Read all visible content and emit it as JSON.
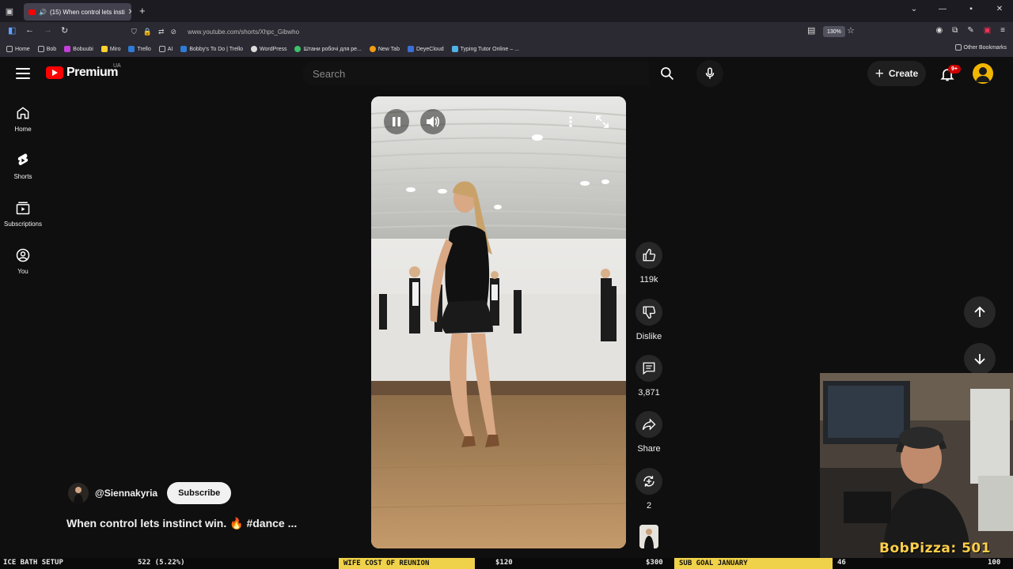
{
  "browser": {
    "tab_title": "(15) When control lets insti",
    "url": "www.youtube.com/shorts/Xhpc_Gibwho",
    "zoom": "130%",
    "bookmarks": [
      {
        "label": "Home",
        "color": "#9aa0a6"
      },
      {
        "label": "Bob",
        "color": "#9aa0a6"
      },
      {
        "label": "Bobuubi",
        "color": "#c43fd8"
      },
      {
        "label": "Miro",
        "color": "#ffd02f"
      },
      {
        "label": "Trello",
        "color": "#2f7bd8"
      },
      {
        "label": "AI",
        "color": "#9aa0a6"
      },
      {
        "label": "Bobby's To Do | Trello",
        "color": "#2f7bd8"
      },
      {
        "label": "WordPress",
        "color": "#dcdcdc"
      },
      {
        "label": "Штани робочі для ре...",
        "color": "#3cc26a"
      },
      {
        "label": "New Tab",
        "color": "#f39c12"
      },
      {
        "label": "DeyeCloud",
        "color": "#3a6fd8"
      },
      {
        "label": "Typing Tutor Online – ...",
        "color": "#4fb3e8"
      }
    ],
    "other_bookmarks": "Other Bookmarks"
  },
  "header": {
    "logo_text": "Premium",
    "country": "UA",
    "search_placeholder": "Search",
    "create_label": "Create",
    "notif_badge": "9+"
  },
  "guide": [
    {
      "label": "Home",
      "icon": "home-icon"
    },
    {
      "label": "Shorts",
      "icon": "shorts-icon"
    },
    {
      "label": "Subscriptions",
      "icon": "subscriptions-icon"
    },
    {
      "label": "You",
      "icon": "you-icon"
    }
  ],
  "actions": {
    "likes": "119k",
    "dislike": "Dislike",
    "comments": "3,871",
    "share": "Share",
    "remix": "2"
  },
  "video": {
    "channel": "@Siennakyria",
    "subscribe": "Subscribe",
    "title": "When control lets instinct win. 🔥 #dance ..."
  },
  "stream": {
    "cam_label": "BobPizza: 501"
  },
  "ticker": {
    "item1": "ICE BATH SETUP",
    "item2": "522 (5.22%)",
    "item3": "WIFE COST OF REUNION",
    "item4": "$120",
    "item5": "$300",
    "item6": "SUB GOAL JANUARY",
    "item7": "46",
    "item8": "100"
  }
}
